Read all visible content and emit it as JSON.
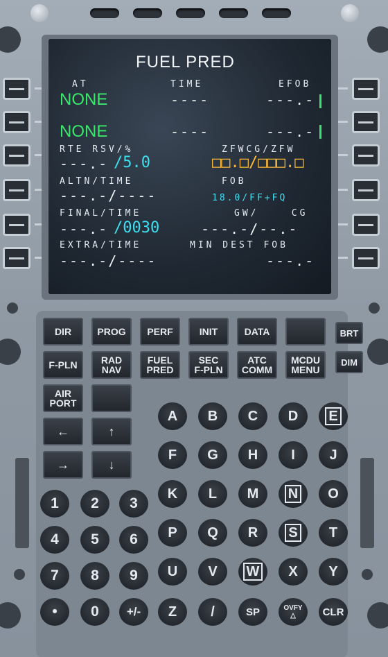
{
  "screen": {
    "title": "FUEL PRED",
    "rows": [
      {
        "label_left": "AT",
        "label_center": "TIME",
        "label_right": "EFOB",
        "data_left": "NONE",
        "data_center": "----",
        "data_right": "---.-"
      },
      {
        "label_left": "",
        "label_center": "",
        "label_right": "",
        "data_left": "NONE",
        "data_center": "----",
        "data_right": "---.-"
      },
      {
        "label_left": "RTE RSV/%",
        "label_center": "",
        "label_right": "ZFWCG/ZFW",
        "data_left_a": "---.-",
        "data_left_b": "/5.0",
        "data_center": "",
        "data_right": "□□.□/□□□.□"
      },
      {
        "label_left": "ALTN/TIME",
        "label_center": "",
        "label_right": "FOB",
        "data_left": "---.-/----",
        "data_center": "",
        "data_right": "18.0/FF+FQ"
      },
      {
        "label_left": "FINAL/TIME",
        "label_center": "",
        "label_right": "GW/    CG",
        "data_left_a": "---.-",
        "data_left_b": "/0030",
        "data_center": "",
        "data_right": "---.-/--.-"
      },
      {
        "label_left": "EXTRA/TIME",
        "label_center": "",
        "label_right": "MIN DEST FOB",
        "data_left": "---.-/----",
        "data_center": "",
        "data_right": "---.-"
      }
    ]
  },
  "function_keys": [
    "DIR",
    "PROG",
    "PERF",
    "INIT",
    "DATA",
    "",
    "F-PLN",
    "RAD\nNAV",
    "FUEL\nPRED",
    "SEC\nF-PLN",
    "ATC\nCOMM",
    "MCDU\nMENU",
    "AIR\nPORT",
    ""
  ],
  "side_keys": {
    "brt": "BRT",
    "dim": "DIM"
  },
  "letters": [
    "A",
    "B",
    "C",
    "D",
    "E",
    "F",
    "G",
    "H",
    "I",
    "J",
    "K",
    "L",
    "M",
    "N",
    "O",
    "P",
    "Q",
    "R",
    "S",
    "T",
    "U",
    "V",
    "W",
    "X",
    "Y",
    "Z",
    "/",
    "SP",
    "OVFY\n△",
    "CLR"
  ],
  "numbers": [
    "1",
    "2",
    "3",
    "4",
    "5",
    "6",
    "7",
    "8",
    "9",
    "•",
    "0",
    "+/-"
  ],
  "arrows": [
    "←",
    "↑",
    "→",
    "↓"
  ],
  "colors": {
    "green": "#39e86a",
    "cyan": "#3fdff0",
    "amber": "#ffbb33",
    "white": "#eef2f5"
  }
}
